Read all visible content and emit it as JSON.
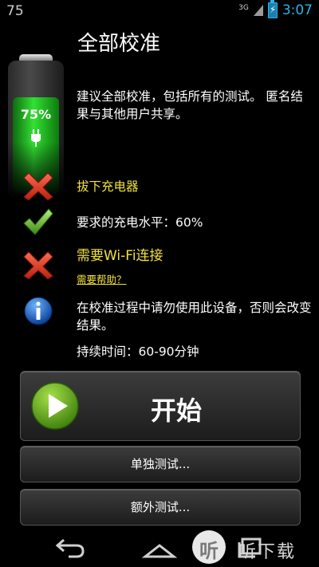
{
  "status_bar": {
    "left_number": "75",
    "network_label": "3G",
    "time": "3:07",
    "time_color": "#2bb3e8"
  },
  "page": {
    "title": "全部校准",
    "battery_percent_label": "75%",
    "battery_level": 0.75,
    "description": "建议全部校准，包括所有的测试。 匿名结果与其他用户共享。"
  },
  "checks": {
    "unplug_charger": "拔下充电器",
    "charge_level": "要求的充电水平：60%",
    "wifi": "需要Wi-Fi连接",
    "help_link": "需要帮助？",
    "info": "在校准过程中请勿使用此设备，否则会改变结果。",
    "duration": "持续时间：60-90分钟",
    "warning_color": "#f2e23c"
  },
  "buttons": {
    "start": "开始",
    "single_test": "单独测试...",
    "extra_test": "额外测试..."
  },
  "watermark": {
    "logo_char": "听",
    "text": "听下载"
  }
}
